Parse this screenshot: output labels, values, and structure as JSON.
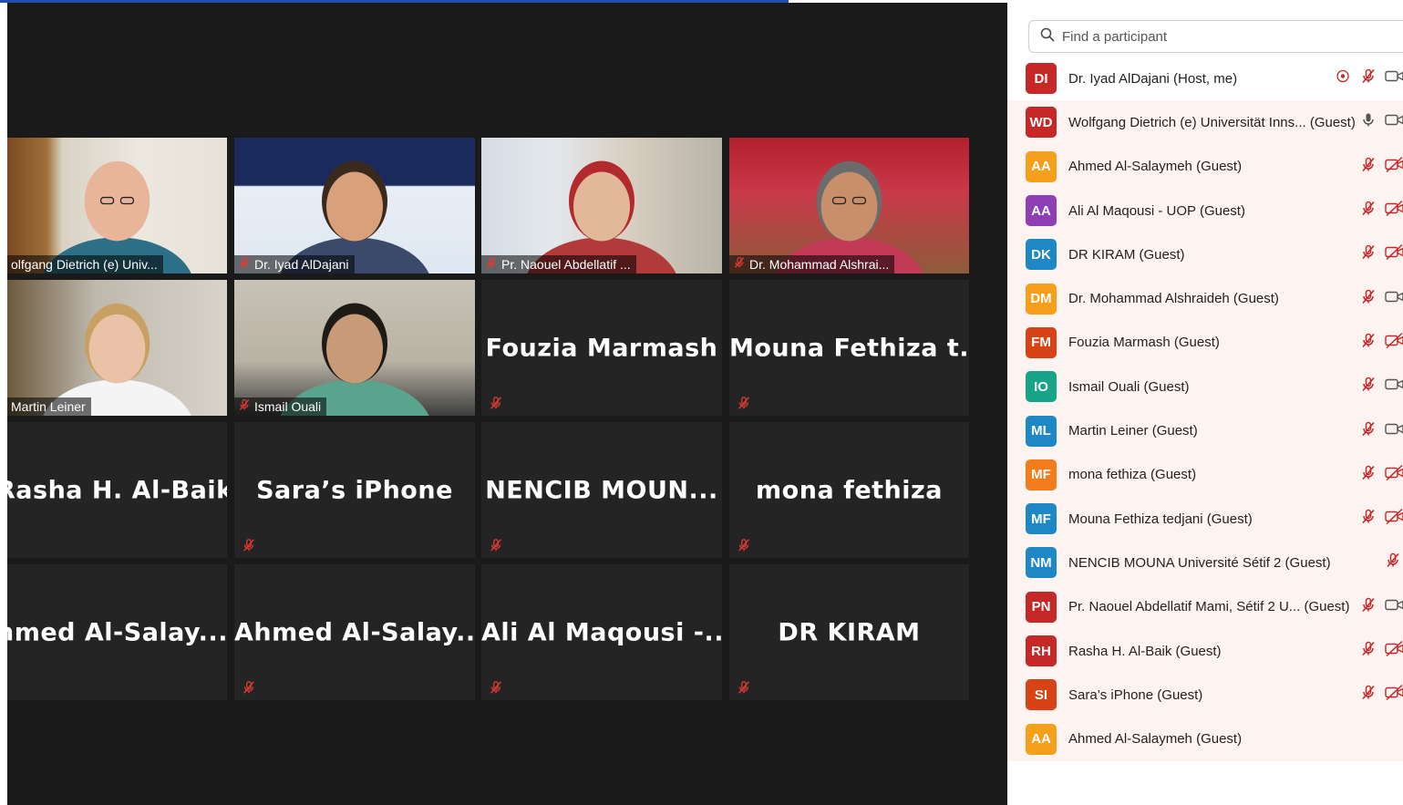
{
  "meeting": {
    "progress_color": "#1f4fb3",
    "active_speaker_color": "#d4e157"
  },
  "video_tiles": [
    {
      "name": "olfgang Dietrich (e) Univ...",
      "has_video": true,
      "muted": false,
      "active": true
    },
    {
      "name": "Dr. Iyad AlDajani",
      "has_video": true,
      "muted": true
    },
    {
      "name": "Pr. Naouel Abdellatif ...",
      "has_video": true,
      "muted": true
    },
    {
      "name": "Dr. Mohammad Alshrai...",
      "has_video": true,
      "muted": true
    },
    {
      "name": "Martin Leiner",
      "has_video": true,
      "muted": false
    },
    {
      "name": "Ismail Ouali",
      "has_video": true,
      "muted": true
    },
    {
      "name": "Fouzia Marmash",
      "has_video": false,
      "muted": true
    },
    {
      "name": "Mouna  Fethiza  t...",
      "has_video": false,
      "muted": true
    },
    {
      "name": "Rasha H. Al-Baik",
      "has_video": false,
      "muted": false
    },
    {
      "name": "Sara’s iPhone",
      "has_video": false,
      "muted": true
    },
    {
      "name": "NENCIB  MOUN...",
      "has_video": false,
      "muted": true
    },
    {
      "name": "mona fethiza",
      "has_video": false,
      "muted": true
    },
    {
      "name": "hmed  Al-Salay...",
      "has_video": false,
      "muted": false
    },
    {
      "name": "Ahmed  Al-Salay...",
      "has_video": false,
      "muted": true
    },
    {
      "name": "Ali Al Maqousi -...",
      "has_video": false,
      "muted": true
    },
    {
      "name": "DR KIRAM",
      "has_video": false,
      "muted": true
    }
  ],
  "participants_panel": {
    "search_placeholder": "Find a participant",
    "participants": [
      {
        "initials": "DI",
        "name": "Dr. Iyad AlDajani (Host, me)",
        "color": "#c62828",
        "mic": "muted",
        "video": "on",
        "sharing": true
      },
      {
        "initials": "WD",
        "name": "Wolfgang Dietrich (e) Universität Inns... (Guest)",
        "color": "#c62828",
        "mic": "on",
        "video": "on"
      },
      {
        "initials": "AA",
        "name": "Ahmed Al-Salaymeh (Guest)",
        "color": "#f59f1a",
        "mic": "muted",
        "video": "off"
      },
      {
        "initials": "AA",
        "name": "Ali Al Maqousi - UOP (Guest)",
        "color": "#8e3fb3",
        "mic": "muted",
        "video": "off"
      },
      {
        "initials": "DK",
        "name": "DR KIRAM (Guest)",
        "color": "#1e88c7",
        "mic": "muted",
        "video": "off"
      },
      {
        "initials": "DM",
        "name": "Dr. Mohammad Alshraideh (Guest)",
        "color": "#f59f1a",
        "mic": "muted",
        "video": "on"
      },
      {
        "initials": "FM",
        "name": "Fouzia Marmash (Guest)",
        "color": "#d84315",
        "mic": "muted",
        "video": "off"
      },
      {
        "initials": "IO",
        "name": "Ismail Ouali (Guest)",
        "color": "#17a589",
        "mic": "muted",
        "video": "on"
      },
      {
        "initials": "ML",
        "name": "Martin Leiner (Guest)",
        "color": "#1e88c7",
        "mic": "muted",
        "video": "on"
      },
      {
        "initials": "MF",
        "name": "mona fethiza (Guest)",
        "color": "#f57c1a",
        "mic": "muted",
        "video": "off"
      },
      {
        "initials": "MF",
        "name": "Mouna Fethiza tedjani (Guest)",
        "color": "#1e88c7",
        "mic": "muted",
        "video": "off"
      },
      {
        "initials": "NM",
        "name": "NENCIB MOUNA Université Sétif 2 (Guest)",
        "color": "#1e88c7",
        "mic": "none",
        "video": "muted-only"
      },
      {
        "initials": "PN",
        "name": "Pr. Naouel Abdellatif Mami, Sétif 2 U...  (Guest)",
        "color": "#c62828",
        "mic": "muted",
        "video": "on"
      },
      {
        "initials": "RH",
        "name": "Rasha H. Al-Baik (Guest)",
        "color": "#c62828",
        "mic": "muted",
        "video": "off"
      },
      {
        "initials": "SI",
        "name": "Sara’s iPhone (Guest)",
        "color": "#d84315",
        "mic": "muted",
        "video": "off"
      },
      {
        "initials": "AA",
        "name": "Ahmed Al-Salaymeh (Guest)",
        "color": "#f59f1a",
        "mic": "none",
        "video": "none"
      }
    ]
  }
}
